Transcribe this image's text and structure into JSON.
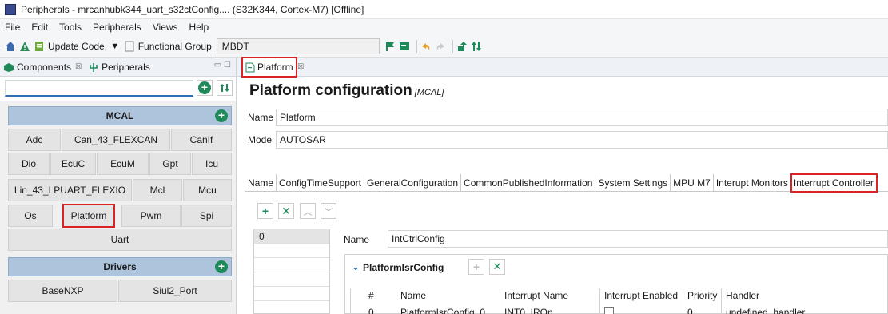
{
  "window": {
    "title": "Peripherals - mrcanhubk344_uart_s32ctConfig.... (S32K344, Cortex-M7) [Offline]"
  },
  "menu": [
    "File",
    "Edit",
    "Tools",
    "Peripherals",
    "Views",
    "Help"
  ],
  "toolbar": {
    "update_code": "Update Code",
    "functional_group_label": "Functional Group",
    "functional_group_value": "MBDT"
  },
  "left_pane": {
    "tabs": [
      {
        "label": "Components"
      },
      {
        "label": "Peripherals"
      }
    ],
    "search_value": "",
    "mcal_header": "MCAL",
    "mcal_components": [
      "Adc",
      "Can_43_FLEXCAN",
      "CanIf",
      "Dio",
      "EcuC",
      "EcuM",
      "Gpt",
      "Icu",
      "Lin_43_LPUART_FLEXIO",
      "Mcl",
      "Mcu",
      "Os",
      "Platform",
      "Pwm",
      "Spi",
      "Uart"
    ],
    "drivers_header": "Drivers",
    "driver_components": [
      "BaseNXP",
      "Siul2_Port"
    ]
  },
  "editor": {
    "tab_label": "Platform",
    "title": "Platform configuration",
    "subtitle": "[MCAL]",
    "name_label": "Name",
    "name_value": "Platform",
    "mode_label": "Mode",
    "mode_value": "AUTOSAR",
    "config_tabs": [
      "Name",
      "ConfigTimeSupport",
      "GeneralConfiguration",
      "CommonPublishedInformation",
      "System Settings",
      "MPU M7",
      "Interupt Monitors",
      "Interrupt Controller"
    ],
    "list_items": [
      "0"
    ],
    "detail_name_label": "Name",
    "detail_name_value": "IntCtrlConfig",
    "section_title": "PlatformIsrConfig",
    "table_headers": [
      "#",
      "Name",
      "Interrupt Name",
      "Interrupt Enabled",
      "Priority",
      "Handler"
    ],
    "table_rows": [
      {
        "index": "0",
        "name": "PlatformIsrConfig_0",
        "interrupt_name": "INT0_IRQn",
        "priority": "0",
        "handler": "undefined_handler"
      }
    ]
  }
}
